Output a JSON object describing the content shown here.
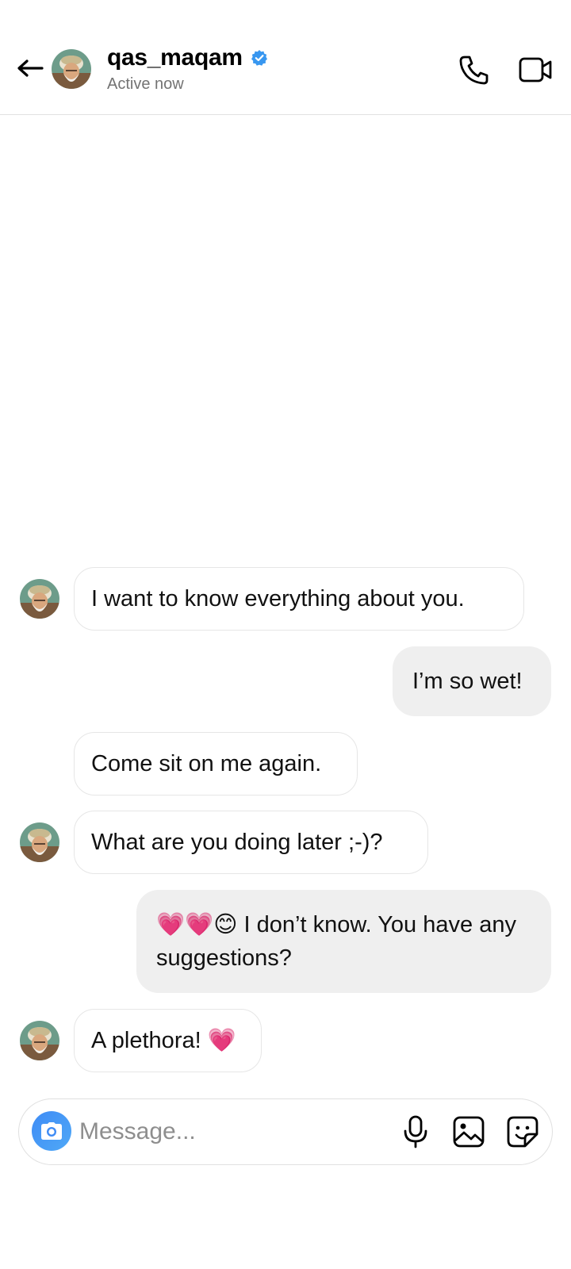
{
  "header": {
    "username": "qas_maqam",
    "status": "Active now",
    "verified": true,
    "icons": {
      "back": "back-arrow-icon",
      "verified": "verified-badge-icon",
      "call": "phone-icon",
      "video": "video-camera-icon"
    }
  },
  "colors": {
    "verified_blue": "#3897f0",
    "incoming_bubble_border": "#e6e6e6",
    "outgoing_bubble_bg": "#efefef",
    "camera_button": "#3f8cf5"
  },
  "messages": [
    {
      "direction": "incoming",
      "show_avatar": true,
      "text": "I want to know everything about you."
    },
    {
      "direction": "outgoing",
      "text": "I’m so wet!"
    },
    {
      "direction": "incoming",
      "show_avatar": false,
      "text": "Come sit on me again."
    },
    {
      "direction": "incoming",
      "show_avatar": true,
      "text": "What are you doing later ;-)?"
    },
    {
      "direction": "outgoing",
      "text_line1": "💗💗😊 I don’t know. You have any",
      "text_line2": "suggestions?"
    },
    {
      "direction": "incoming",
      "show_avatar": true,
      "text": "A plethora! 💗"
    }
  ],
  "composer": {
    "placeholder": "Message...",
    "icons": {
      "camera": "camera-icon",
      "mic": "microphone-icon",
      "gallery": "image-gallery-icon",
      "sticker": "sticker-icon"
    }
  }
}
